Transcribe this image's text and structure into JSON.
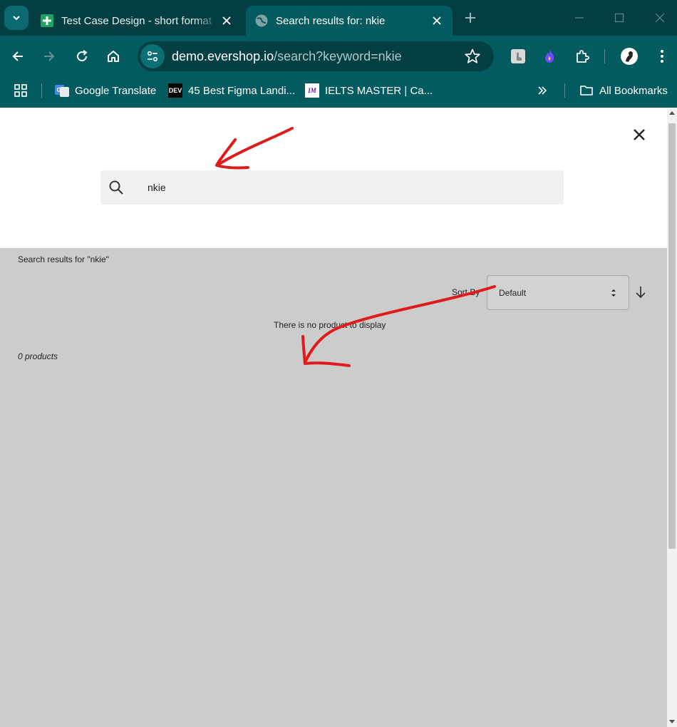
{
  "browser": {
    "tabs": [
      {
        "title": "Test Case Design - short format",
        "icon": "google-sheets-icon",
        "active": false
      },
      {
        "title": "Search results for: nkie",
        "icon": "globe-icon",
        "active": true
      }
    ],
    "url": {
      "host": "demo.evershop.io",
      "path": "/search?keyword=nkie"
    },
    "bookmarks": [
      {
        "label": "Google Translate",
        "icon": "google-translate-icon"
      },
      {
        "label": "45 Best Figma Landi...",
        "icon": "dev-icon",
        "icon_text": "DEV"
      },
      {
        "label": "IELTS MASTER | Ca...",
        "icon": "ielts-icon",
        "icon_text": "IM"
      }
    ],
    "all_bookmarks_label": "All Bookmarks",
    "accent": "#035b60"
  },
  "search": {
    "value": "nkie",
    "results_title": "Search results for \"nkie\"",
    "sort_label": "Sort By",
    "sort_value": "Default",
    "empty_message": "There is no product to display",
    "count_label": "0 products"
  },
  "annotation_color": "#e01b1b"
}
